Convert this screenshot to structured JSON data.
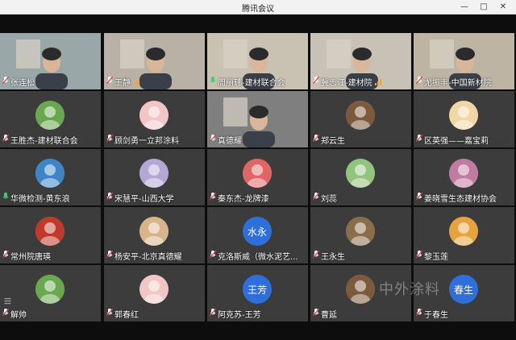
{
  "window": {
    "title": "腾讯会议",
    "min_icon": "minimize-icon",
    "max_icon": "maximize-icon",
    "close_icon": "close-icon"
  },
  "participants": [
    {
      "name": "张连松",
      "mic": "muted",
      "kind": "video"
    },
    {
      "name": "王静",
      "mic": "muted",
      "kind": "video",
      "signal": true
    },
    {
      "name": "周丽玮-建材联合会",
      "mic": "active",
      "kind": "video"
    },
    {
      "name": "冀志江-建材院",
      "mic": "muted",
      "kind": "video",
      "signal": true
    },
    {
      "name": "尤振丰-中国新材院",
      "mic": "muted",
      "kind": "video"
    },
    {
      "name": "王胜杰-建材联合会",
      "mic": "muted",
      "kind": "avatar"
    },
    {
      "name": "顾剑勇一立邦涂料",
      "mic": "muted",
      "kind": "avatar"
    },
    {
      "name": "真德耀",
      "mic": "muted",
      "kind": "video"
    },
    {
      "name": "郑云生",
      "mic": "muted",
      "kind": "avatar"
    },
    {
      "name": "区英强——嘉宝莉",
      "mic": "muted",
      "kind": "avatar"
    },
    {
      "name": "华微检测-黄东浪",
      "mic": "active",
      "kind": "avatar"
    },
    {
      "name": "宋慧平-山西大学",
      "mic": "muted",
      "kind": "avatar"
    },
    {
      "name": "秦东杰-龙牌漆",
      "mic": "muted",
      "kind": "avatar"
    },
    {
      "name": "刘蕊",
      "mic": "muted",
      "kind": "avatar"
    },
    {
      "name": "姜晓雪生态建材协会",
      "mic": "muted",
      "kind": "avatar"
    },
    {
      "name": "常州院唐瑛",
      "mic": "muted",
      "kind": "avatar"
    },
    {
      "name": "杨安平-北京真德耀",
      "mic": "muted",
      "kind": "avatar"
    },
    {
      "name": "克洛斯威（微水泥艺...",
      "mic": "muted",
      "kind": "text",
      "initials": "水永"
    },
    {
      "name": "王永生",
      "mic": "muted",
      "kind": "avatar"
    },
    {
      "name": "黎玉莲",
      "mic": "muted",
      "kind": "avatar"
    },
    {
      "name": "解帅",
      "mic": "muted",
      "kind": "avatar"
    },
    {
      "name": "郭春红",
      "mic": "muted",
      "kind": "avatar"
    },
    {
      "name": "阿克苏-王芳",
      "mic": "muted",
      "kind": "text",
      "initials": "王芳"
    },
    {
      "name": "曹延",
      "mic": "muted",
      "kind": "avatar"
    },
    {
      "name": "于春生",
      "mic": "muted",
      "kind": "text",
      "initials": "春生"
    }
  ],
  "watermark": "中外涂料"
}
